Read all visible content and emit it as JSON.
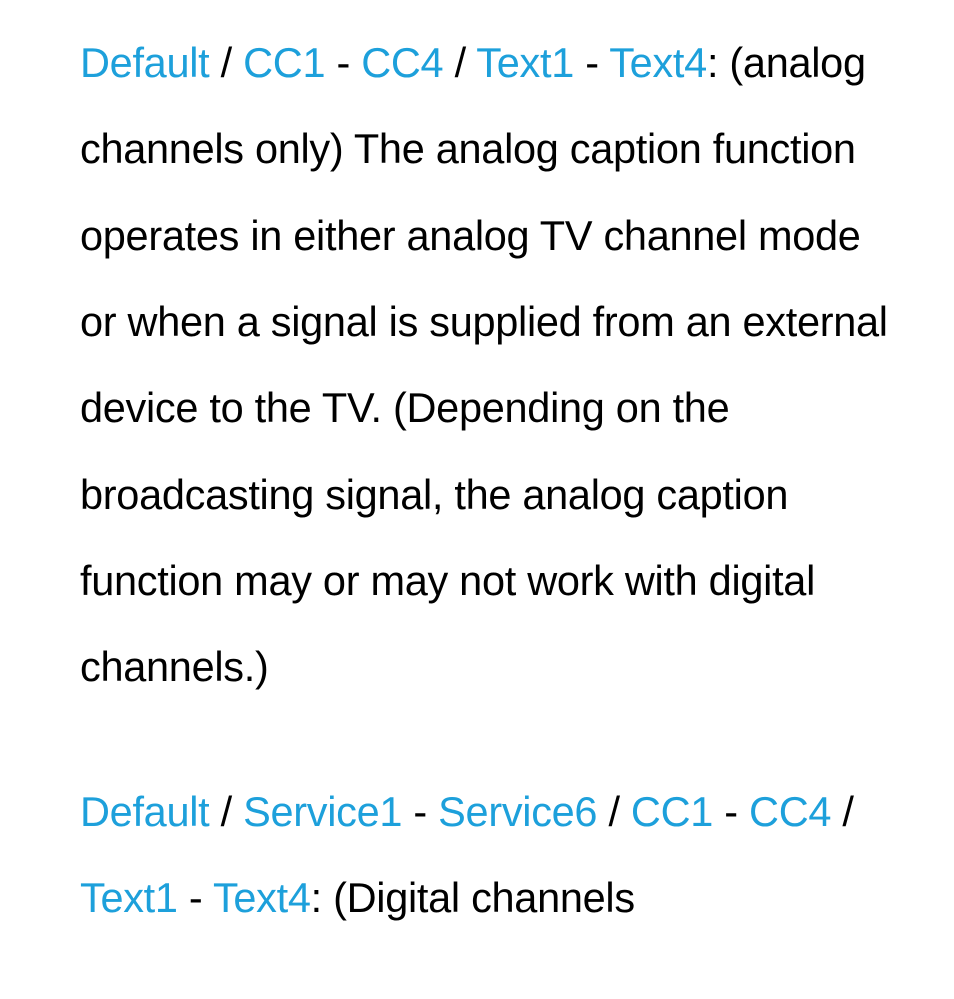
{
  "section1": {
    "hl_default": "Default",
    "sep1": " / ",
    "hl_cc1": "CC1",
    "dash1": " - ",
    "hl_cc4": "CC4",
    "sep2": " / ",
    "hl_text1": "Text1",
    "dash2": " - ",
    "hl_text4": "Text4",
    "colon_body": ": (analog channels only) The analog caption function operates in either analog TV channel mode or when a signal is supplied from an external device to the TV. (Depending on the broadcasting signal, the analog caption function may or may not work with digital channels.)"
  },
  "section2": {
    "hl_default": "Default",
    "sep1": " / ",
    "hl_service1": "Service1",
    "dash1": " - ",
    "hl_service6": "Service6",
    "sep2": " / ",
    "hl_cc1": "CC1",
    "dash2": " - ",
    "hl_cc4": "CC4",
    "sep3": " / ",
    "hl_text1": "Text1",
    "dash3": " - ",
    "hl_text4": "Text4",
    "colon_body": ": (Digital channels"
  }
}
